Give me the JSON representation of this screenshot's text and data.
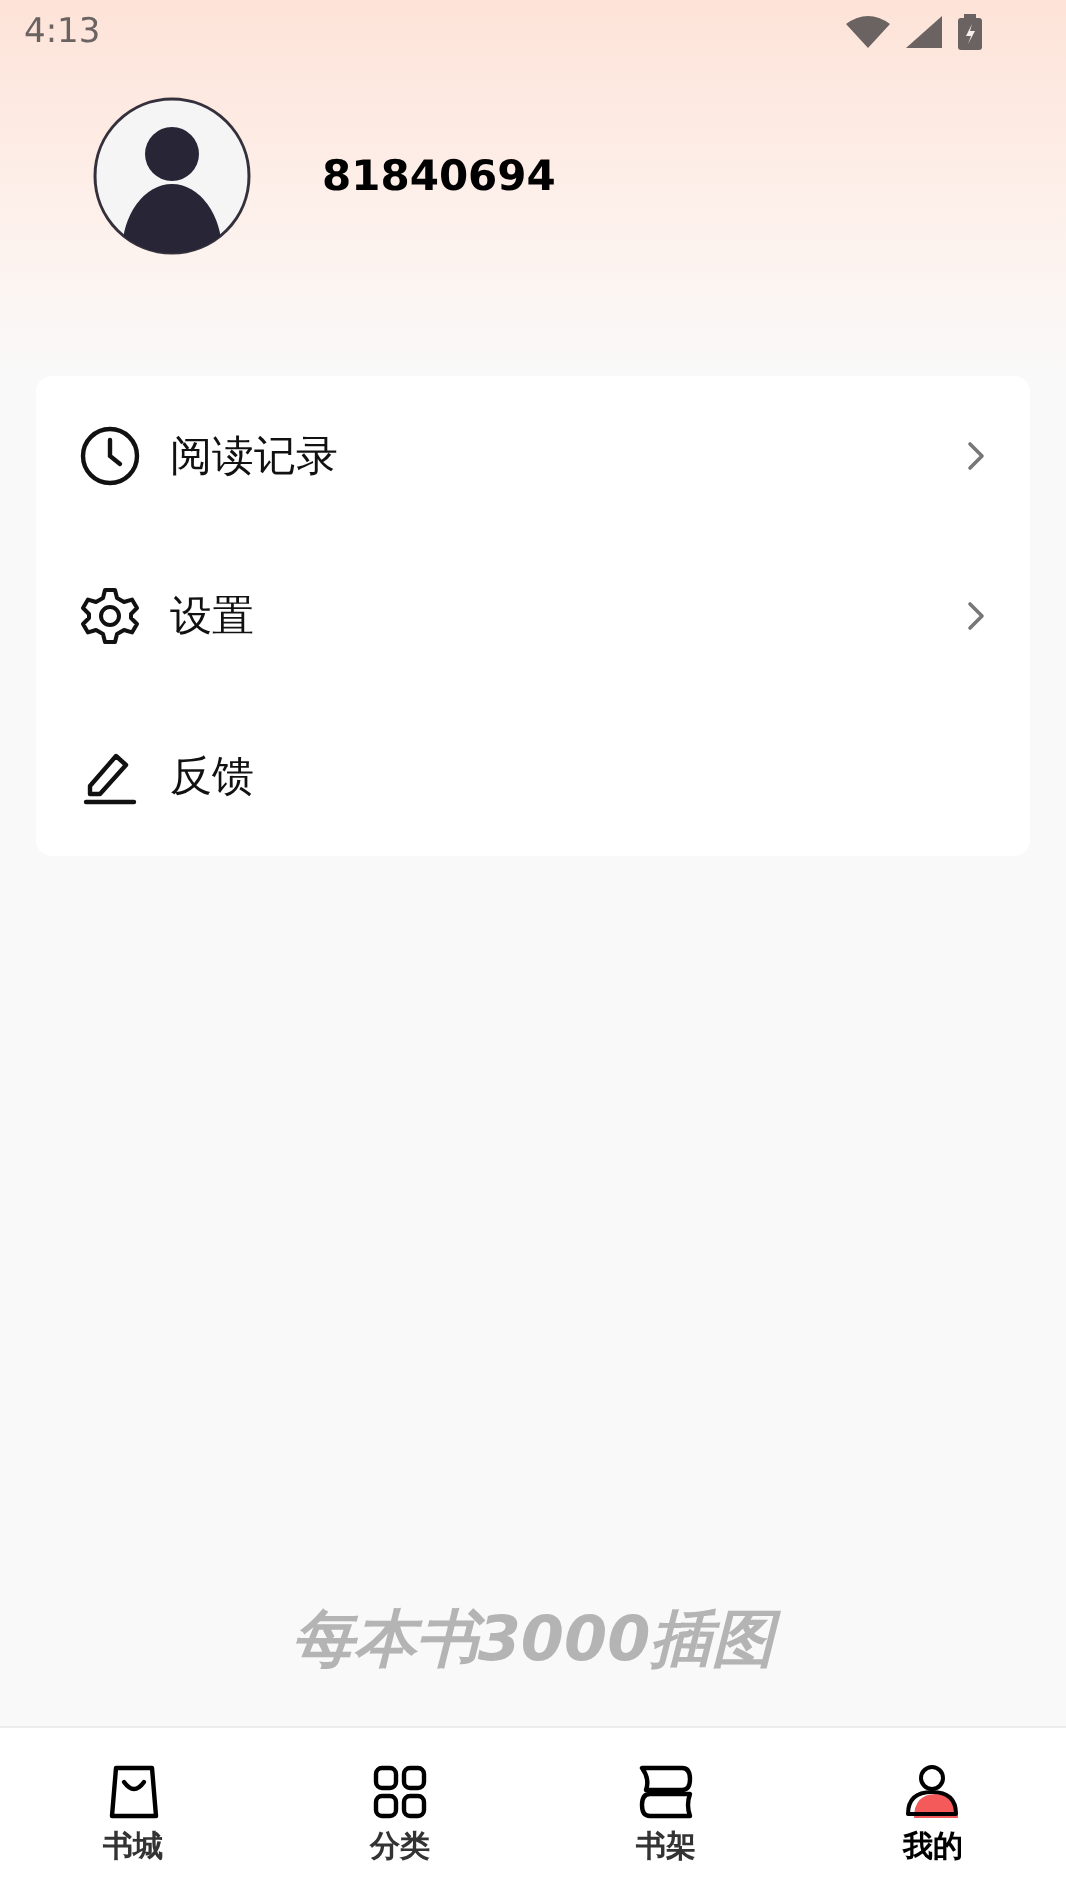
{
  "status_bar": {
    "time": "4:13"
  },
  "profile": {
    "user_id": "81840694"
  },
  "menu": [
    {
      "label": "阅读记录",
      "has_arrow": true
    },
    {
      "label": "设置",
      "has_arrow": true
    },
    {
      "label": "反馈",
      "has_arrow": false
    }
  ],
  "slogan": "每本书3000插图",
  "tabs": [
    {
      "label": "书城",
      "selected": false
    },
    {
      "label": "分类",
      "selected": false
    },
    {
      "label": "书架",
      "selected": false
    },
    {
      "label": "我的",
      "selected": true
    }
  ]
}
